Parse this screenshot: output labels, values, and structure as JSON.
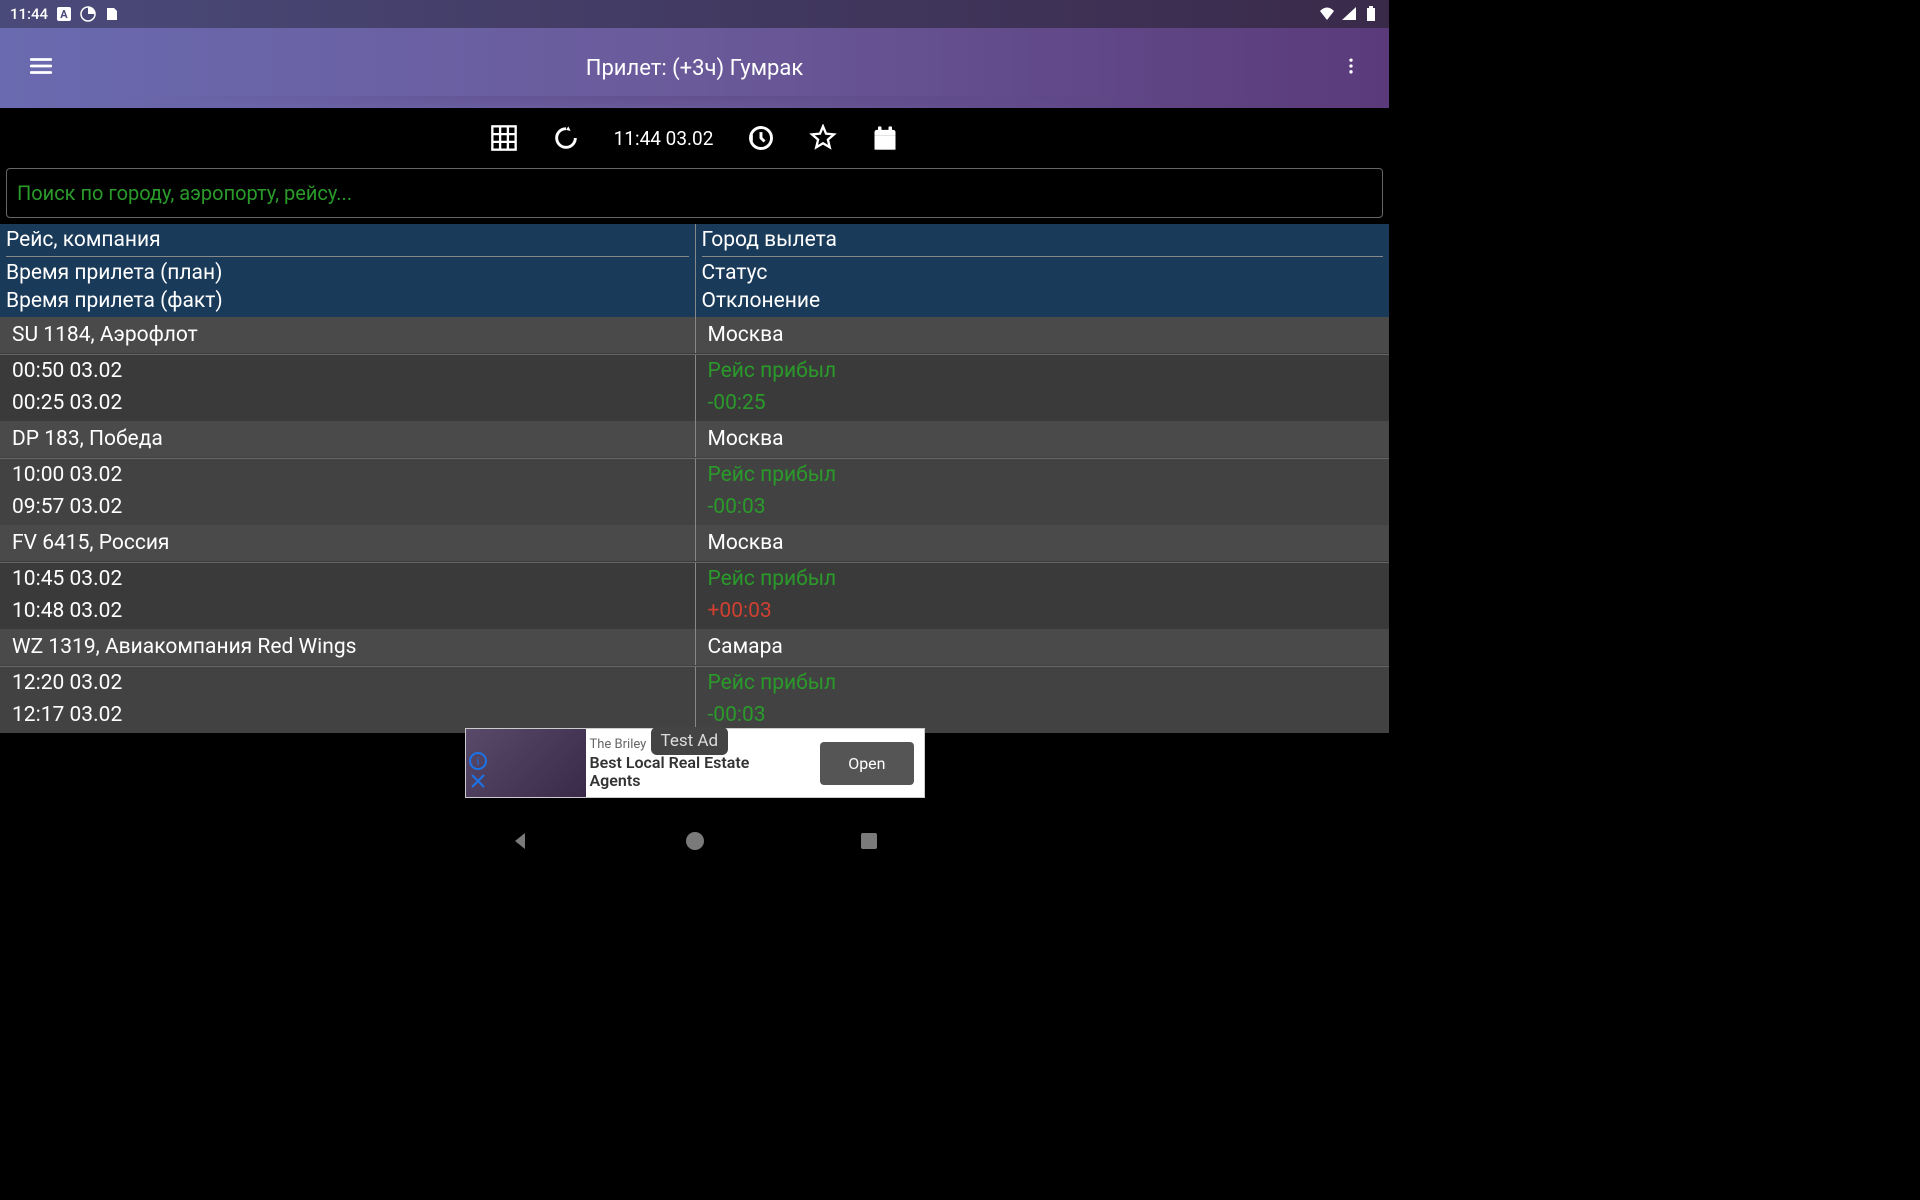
{
  "status": {
    "time": "11:44"
  },
  "appbar": {
    "title": "Прилет: (+3ч) Гумрак"
  },
  "toolbar": {
    "datetime": "11:44 03.02"
  },
  "search": {
    "placeholder": "Поиск по городу, аэропорту, рейсу..."
  },
  "headers": {
    "flight": "Рейс, компания",
    "city": "Город вылета",
    "time_plan": "Время прилета (план)",
    "time_fact": "Время прилета (факт)",
    "status": "Статус",
    "deviation": "Отклонение"
  },
  "rows": [
    {
      "flight": "SU 1184, Аэрофлот",
      "city": "Москва",
      "time_plan": "00:50 03.02",
      "time_fact": "00:25 03.02",
      "status": "Рейс прибыл",
      "deviation": "-00:25",
      "dev_color": "green"
    },
    {
      "flight": "DP 183, Победа",
      "city": "Москва",
      "time_plan": "10:00 03.02",
      "time_fact": "09:57 03.02",
      "status": "Рейс прибыл",
      "deviation": "-00:03",
      "dev_color": "green"
    },
    {
      "flight": "FV 6415, Россия",
      "city": "Москва",
      "time_plan": "10:45 03.02",
      "time_fact": "10:48 03.02",
      "status": "Рейс прибыл",
      "deviation": "+00:03",
      "dev_color": "red"
    },
    {
      "flight": "WZ 1319, Авиакомпания Red Wings",
      "city": "Самара",
      "time_plan": "12:20 03.02",
      "time_fact": "12:17 03.02",
      "status": "Рейс прибыл",
      "deviation": "-00:03",
      "dev_color": "green"
    }
  ],
  "ad": {
    "subtitle": "The Briley",
    "title1": "Best Local Real Estate",
    "title2": "Agents",
    "testlabel": "Test Ad",
    "open": "Open"
  }
}
